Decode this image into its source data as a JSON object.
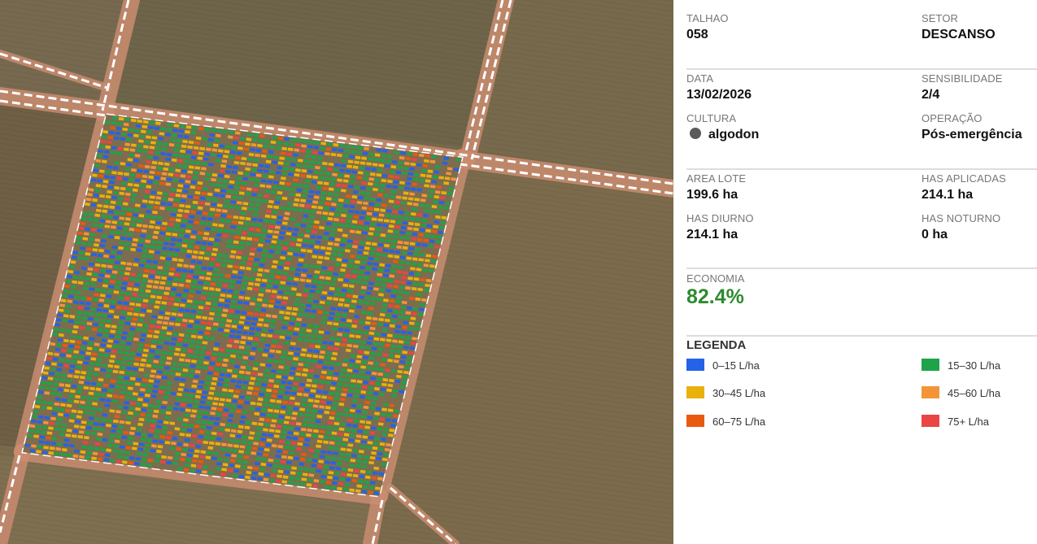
{
  "map": {
    "swatches": [
      "#2463e8",
      "#1fa34a",
      "#e8b10c",
      "#f39438",
      "#e85a10",
      "#ea4545"
    ]
  },
  "fields": {
    "talhao": {
      "label": "TALHAO",
      "value": "058"
    },
    "setor": {
      "label": "SETOR",
      "value": "DESCANSO"
    },
    "data": {
      "label": "DATA",
      "value": "13/02/2026"
    },
    "sensibilidade": {
      "label": "SENSIBILIDADE",
      "value": "2/4"
    },
    "cultura": {
      "label": "CULTURA",
      "value": "algodon",
      "dot_color": "#5a5a5a"
    },
    "operacao": {
      "label": "OPERAÇÃO",
      "value": "Pós-emergência"
    },
    "area_lote": {
      "label": "AREA LOTE",
      "value": "199.6 ha"
    },
    "has_aplicadas": {
      "label": "HAS APLICADAS",
      "value": "214.1 ha"
    },
    "has_diurno": {
      "label": "HAS DIURNO",
      "value": "214.1 ha"
    },
    "has_noturno": {
      "label": "HAS NOTURNO",
      "value": "0 ha"
    }
  },
  "economia": {
    "label": "ECONOMIA",
    "value": "82.4%",
    "color": "#2e8b2e"
  },
  "legenda": {
    "title": "LEGENDA",
    "items": [
      {
        "label": "0–15 L/ha",
        "color": "#2463e8"
      },
      {
        "label": "15–30 L/ha",
        "color": "#1fa34a"
      },
      {
        "label": "30–45 L/ha",
        "color": "#e8b10c"
      },
      {
        "label": "45–60 L/ha",
        "color": "#f39438"
      },
      {
        "label": "60–75 L/ha",
        "color": "#e85a10"
      },
      {
        "label": "75+ L/ha",
        "color": "#ea4545"
      }
    ]
  }
}
